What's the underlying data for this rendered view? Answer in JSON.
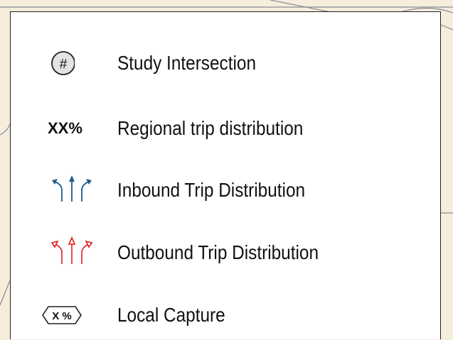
{
  "legend": {
    "items": [
      {
        "symbol": "#",
        "label": "Study Intersection",
        "icon": "study-intersection-circle-icon"
      },
      {
        "symbol": "XX%",
        "label": "Regional trip distribution",
        "icon": "regional-percent-text"
      },
      {
        "label": "Inbound Trip Distribution",
        "icon": "inbound-arrows-icon",
        "color": "#1f5d8c"
      },
      {
        "label": "Outbound Trip Distribution",
        "icon": "outbound-arrows-icon",
        "color": "#e11d1d"
      },
      {
        "symbol": "X %",
        "label": "Local Capture",
        "icon": "local-capture-hexagon-icon"
      }
    ]
  },
  "colors": {
    "inbound": "#1f5d8c",
    "outbound": "#e11d1d",
    "map_background": "#f6eddc",
    "map_lines": "#8a8a94"
  }
}
